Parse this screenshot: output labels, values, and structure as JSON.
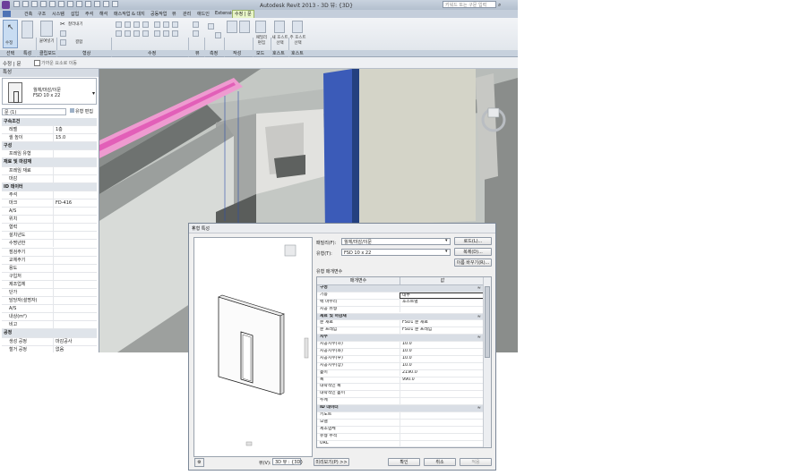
{
  "app": {
    "title": "Autodesk Revit 2013 - 3D 뷰: {3D}",
    "search_placeholder": "키워드 또는 구문 입력"
  },
  "tabs": [
    "건축",
    "구조",
    "시스템",
    "삽입",
    "주석",
    "해석",
    "매스작업 & 대지",
    "공동작업",
    "뷰",
    "관리",
    "애드인",
    "Extensions",
    "수정 | 문"
  ],
  "active_tab_index": 12,
  "ribbon": {
    "modify_label": "수정",
    "paste_label": "붙여넣기",
    "cut_label": "잘라내기",
    "join_label": "결합",
    "panels": [
      "선택",
      "특성",
      "클립보드",
      "형상",
      "수정",
      "뷰",
      "측정",
      "작성",
      "모드",
      "호스트",
      "호스트"
    ],
    "edit_family_label": "패밀리 편집",
    "pick_host_label": "새 호스트 선택",
    "pick_host2_label": "주 호스트 선택"
  },
  "option_bar": {
    "mode": "수정 | 문",
    "checkbox_label": "가까운 요소로 이동"
  },
  "properties": {
    "title": "특성",
    "type_family": "월체/마감/이문",
    "type_name": "FSD 10 x 22",
    "selector": "문 (1)",
    "edit_type": "유형 편집",
    "rows": [
      {
        "group": true,
        "name": "구속조건"
      },
      {
        "name": "레벨",
        "value": "1층"
      },
      {
        "name": "씰 높이",
        "value": "15.0"
      },
      {
        "group": true,
        "name": "구성"
      },
      {
        "name": "프레임 유형",
        "value": ""
      },
      {
        "group": true,
        "name": "재료 및 마감재"
      },
      {
        "name": "프레임 재료",
        "value": ""
      },
      {
        "name": "마감",
        "value": ""
      },
      {
        "group": true,
        "name": "ID 데이터"
      },
      {
        "name": "주석",
        "value": ""
      },
      {
        "name": "마크",
        "value": "FD-416"
      },
      {
        "name": "A/S",
        "value": ""
      },
      {
        "name": "위치",
        "value": ""
      },
      {
        "name": "협력",
        "value": ""
      },
      {
        "name": "설치년도",
        "value": ""
      },
      {
        "name": "수명년한",
        "value": ""
      },
      {
        "name": "점검주기",
        "value": ""
      },
      {
        "name": "교체주기",
        "value": ""
      },
      {
        "name": "용도",
        "value": ""
      },
      {
        "name": "구입처",
        "value": ""
      },
      {
        "name": "제조업체",
        "value": ""
      },
      {
        "name": "단가",
        "value": ""
      },
      {
        "name": "담당자(설명자)",
        "value": ""
      },
      {
        "name": "A/S",
        "value": ""
      },
      {
        "name": "내상(m²)",
        "value": ""
      },
      {
        "name": "비고",
        "value": ""
      },
      {
        "group": true,
        "name": "공정"
      },
      {
        "name": "생성 공정",
        "value": "마감공사"
      },
      {
        "name": "철거 공정",
        "value": "없음"
      },
      {
        "group": true,
        "name": "기타"
      },
      {
        "name": "헤드 높이",
        "value": "2205.0"
      }
    ]
  },
  "dialog": {
    "title": "유형 특성",
    "family_label": "패밀리(F):",
    "family_value": "월체/마감/이문",
    "type_label": "유형(T):",
    "type_value": "FSD 10 x 22",
    "load_btn": "로드(L)...",
    "duplicate_btn": "복제(D)...",
    "rename_btn": "이름 바꾸기(R)...",
    "type_params_label": "유형 매개변수",
    "col_param": "매개변수",
    "col_value": "값",
    "rows": [
      {
        "group": true,
        "name": "구성"
      },
      {
        "name": "기능",
        "value": "내부",
        "sel": true
      },
      {
        "name": "벽 마무리",
        "value": "호스트별"
      },
      {
        "name": "시공 유형",
        "value": ""
      },
      {
        "group": true,
        "name": "재료 및 마감재"
      },
      {
        "name": "문 재료",
        "value": "FSD1 문 재료"
      },
      {
        "name": "문 프레임",
        "value": "FSD1 문 프레임"
      },
      {
        "group": true,
        "name": "치수"
      },
      {
        "name": "시공치수(하)",
        "value": "10.0"
      },
      {
        "name": "시공치수(좌)",
        "value": "10.0"
      },
      {
        "name": "시공치수(우)",
        "value": "10.0"
      },
      {
        "name": "시공치수(상)",
        "value": "10.0"
      },
      {
        "name": "높이",
        "value": "2190.0"
      },
      {
        "name": "폭",
        "value": "990.0"
      },
      {
        "name": "대략적인 폭",
        "value": ""
      },
      {
        "name": "대략적인 높이",
        "value": ""
      },
      {
        "name": "두께",
        "value": ""
      },
      {
        "group": true,
        "name": "ID 데이터"
      },
      {
        "name": "키노트",
        "value": ""
      },
      {
        "name": "모델",
        "value": ""
      },
      {
        "name": "제조업체",
        "value": ""
      },
      {
        "name": "유형 주석",
        "value": ""
      },
      {
        "name": "URL",
        "value": ""
      },
      {
        "name": "설명",
        "value": ""
      },
      {
        "name": "조립 코드",
        "value": ""
      }
    ],
    "view_label": "뷰(V):",
    "view_value": "3D 뷰 : {3D}",
    "preview_btn": "미리보기(P) >>",
    "ok_btn": "확인",
    "cancel_btn": "취소",
    "apply_btn": "적용"
  }
}
